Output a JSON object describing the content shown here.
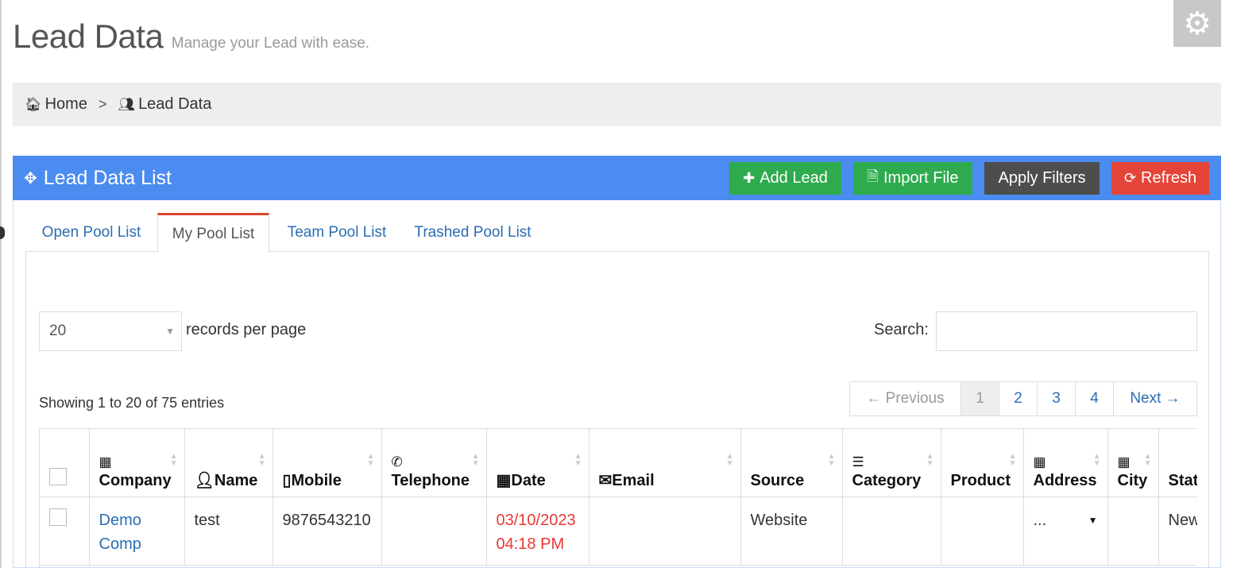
{
  "header": {
    "title": "Lead Data",
    "subtitle": "Manage your Lead with ease."
  },
  "breadcrumb": {
    "home_icon": "home-icon",
    "home": "Home",
    "separator": ">",
    "users_icon": "users-icon",
    "current": "Lead Data"
  },
  "portlet": {
    "title": "Lead Data List",
    "color": "#4a8cf0",
    "buttons": {
      "add_lead": "Add Lead",
      "import_file": "Import File",
      "apply_filters": "Apply Filters",
      "refresh": "Refresh"
    }
  },
  "tabs": [
    {
      "label": "Open Pool List",
      "active": false
    },
    {
      "label": "My Pool List",
      "active": true
    },
    {
      "label": "Team Pool List",
      "active": false
    },
    {
      "label": "Trashed Pool List",
      "active": false
    }
  ],
  "controls": {
    "per_page_value": "20",
    "per_page_label": "records per page",
    "search_label": "Search:",
    "search_value": "",
    "showing": "Showing 1 to 20 of 75 entries"
  },
  "pagination": {
    "previous": "← Previous",
    "pages": [
      "1",
      "2",
      "3",
      "4"
    ],
    "current_page": "1",
    "next": "Next →"
  },
  "table": {
    "columns": [
      "Company",
      "Name",
      "Mobile",
      "Telephone",
      "Date",
      "Email",
      "Source",
      "Category",
      "Product",
      "Address",
      "City",
      "Stat"
    ],
    "rows": [
      {
        "company": "Demo Comp",
        "name": "test",
        "mobile": "9876543210",
        "telephone": "",
        "date": "03/10/2023",
        "time": "04:18 PM",
        "email": "",
        "source": "Website",
        "category": "",
        "product": "",
        "address": "...",
        "city": "",
        "status": "New"
      }
    ]
  },
  "colors": {
    "green": "#2eab4e",
    "dark": "#4d4d4d",
    "red": "#e54439",
    "link": "#2a6eb1",
    "date_red": "#e53935"
  }
}
